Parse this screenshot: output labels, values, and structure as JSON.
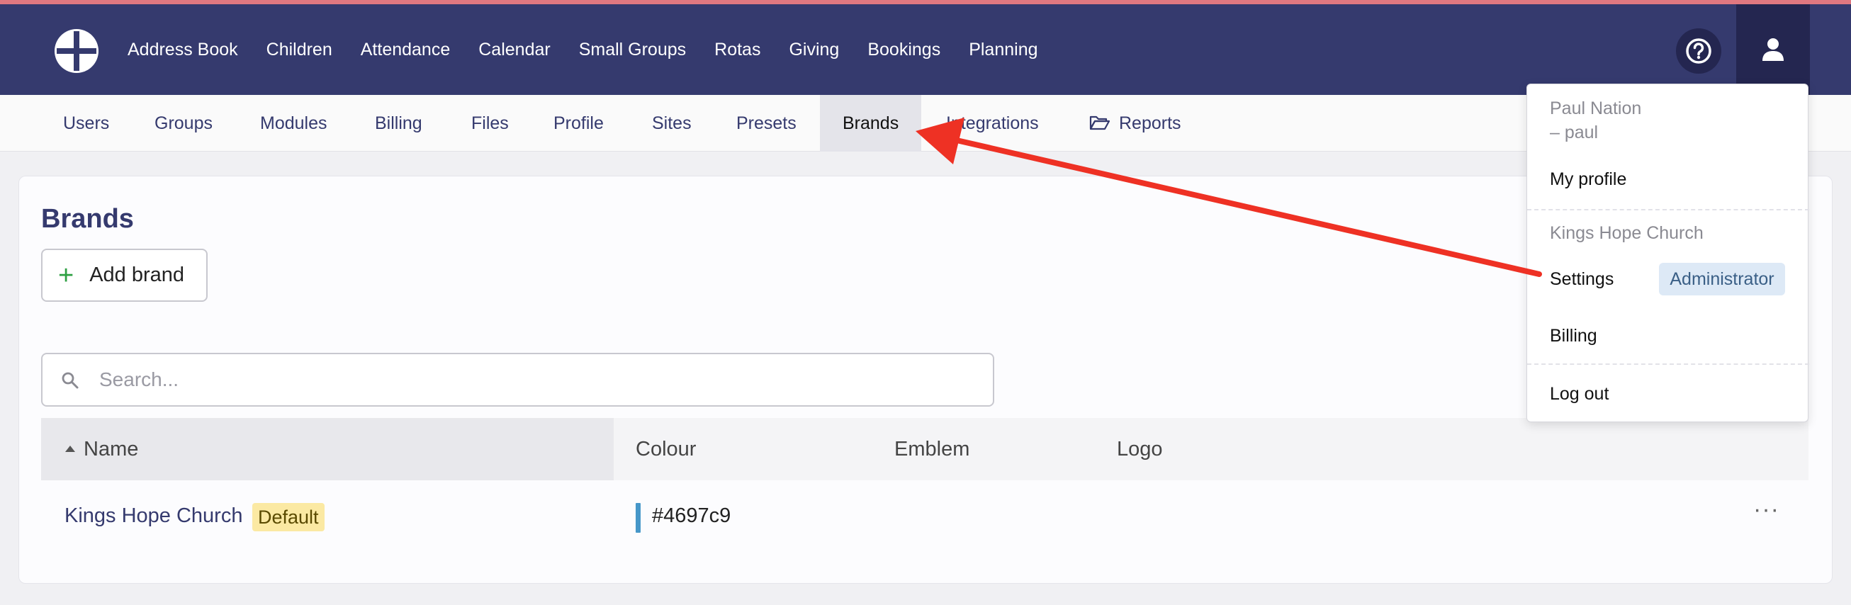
{
  "brand_colors": {
    "topbar": "#353a6e",
    "accent_stripe": "#e07880",
    "brand_swatch": "#4697c9",
    "annotation_arrow": "#ee3124"
  },
  "main_nav": {
    "items": [
      "Address Book",
      "Children",
      "Attendance",
      "Calendar",
      "Small Groups",
      "Rotas",
      "Giving",
      "Bookings",
      "Planning"
    ],
    "help_icon": "question-circle-icon",
    "user_icon": "user-icon"
  },
  "sub_nav": {
    "tabs": [
      "Users",
      "Groups",
      "Modules",
      "Billing",
      "Files",
      "Profile",
      "Sites",
      "Presets",
      "Brands",
      "Integrations",
      "Reports"
    ],
    "active": "Brands",
    "reports_icon": "folder-open-icon"
  },
  "page": {
    "title": "Brands",
    "add_button_label": "Add brand",
    "search_placeholder": "Search..."
  },
  "table": {
    "columns": [
      "Name",
      "Colour",
      "Emblem",
      "Logo"
    ],
    "sort_column": "Name",
    "rows": [
      {
        "name": "Kings Hope Church",
        "badge": "Default",
        "colour": "#4697c9",
        "emblem": "",
        "logo": ""
      }
    ]
  },
  "user_menu": {
    "user_name": "Paul Nation",
    "username": "– paul",
    "my_profile": "My profile",
    "org_name": "Kings Hope Church",
    "settings": "Settings",
    "role_badge": "Administrator",
    "billing": "Billing",
    "logout": "Log out"
  }
}
